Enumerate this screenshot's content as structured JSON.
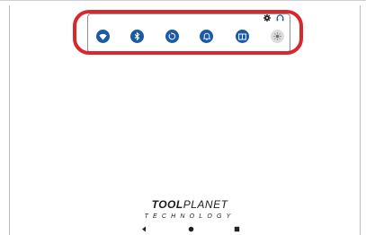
{
  "quick_settings": {
    "tiles": [
      {
        "name": "wifi",
        "icon": "wifi-icon",
        "state": "on"
      },
      {
        "name": "bluetooth",
        "icon": "bluetooth-icon",
        "state": "on"
      },
      {
        "name": "auto-rotate",
        "icon": "rotate-icon",
        "state": "on"
      },
      {
        "name": "notifications",
        "icon": "bell-icon",
        "state": "on"
      },
      {
        "name": "screen-cast",
        "icon": "book-icon",
        "state": "on"
      },
      {
        "name": "brightness",
        "icon": "brightness-icon",
        "state": "off"
      }
    ],
    "header_icons": [
      "settings-gear-icon",
      "headset-icon"
    ]
  },
  "logo": {
    "main_bold": "TOOL",
    "main_light": "PLANET",
    "sub": "TECHNOLOGY"
  },
  "navbar": {
    "buttons": [
      "back-icon",
      "home-icon",
      "recents-icon"
    ]
  },
  "colors": {
    "tile_active": "#1a5aa6",
    "tile_inactive": "#dcdcdc",
    "highlight": "#d9272e"
  }
}
